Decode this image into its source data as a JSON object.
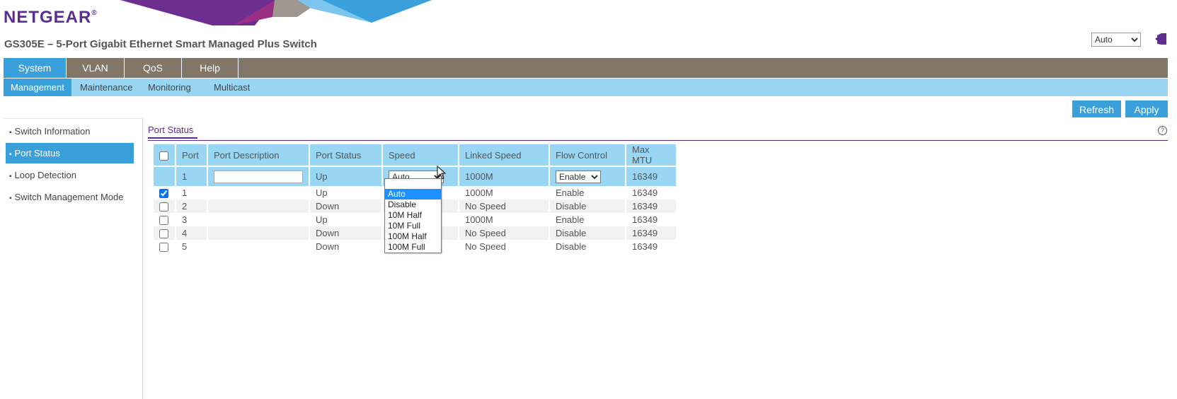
{
  "header": {
    "logo": "NETGEAR",
    "logo_mark": "®",
    "product_title": "GS305E – 5-Port Gigabit Ethernet Smart Managed Plus Switch",
    "language_value": "Auto"
  },
  "main_nav": [
    {
      "label": "System",
      "active": true
    },
    {
      "label": "VLAN",
      "active": false
    },
    {
      "label": "QoS",
      "active": false
    },
    {
      "label": "Help",
      "active": false
    }
  ],
  "sub_nav": [
    {
      "label": "Management",
      "active": true
    },
    {
      "label": "Maintenance",
      "active": false
    },
    {
      "label": "Monitoring",
      "active": false
    },
    {
      "label": "Multicast",
      "active": false
    }
  ],
  "actions": {
    "refresh": "Refresh",
    "apply": "Apply"
  },
  "sidebar": [
    {
      "label": "Switch Information",
      "active": false
    },
    {
      "label": "Port Status",
      "active": true
    },
    {
      "label": "Loop Detection",
      "active": false
    },
    {
      "label": "Switch Management Mode",
      "active": false
    }
  ],
  "bullet": "▪",
  "section": {
    "tab": "Port Status",
    "help": "?"
  },
  "table": {
    "headers": [
      "Port",
      "Port Description",
      "Port Status",
      "Speed",
      "Linked Speed",
      "Flow Control",
      "Max MTU"
    ],
    "edit_row": {
      "port": "1",
      "description": "",
      "status": "Up",
      "speed": "Auto",
      "linked_speed": "1000M",
      "flow_control": "Enable",
      "mtu": "16349"
    },
    "rows": [
      {
        "checked": true,
        "port": "1",
        "status": "Up",
        "linked_speed": "1000M",
        "flow_control": "Enable",
        "mtu": "16349"
      },
      {
        "checked": false,
        "port": "2",
        "status": "Down",
        "linked_speed": "No Speed",
        "flow_control": "Disable",
        "mtu": "16349"
      },
      {
        "checked": false,
        "port": "3",
        "status": "Up",
        "linked_speed": "1000M",
        "flow_control": "Enable",
        "mtu": "16349"
      },
      {
        "checked": false,
        "port": "4",
        "status": "Down",
        "linked_speed": "No Speed",
        "flow_control": "Disable",
        "mtu": "16349"
      },
      {
        "checked": false,
        "port": "5",
        "status": "Down",
        "linked_speed": "No Speed",
        "flow_control": "Disable",
        "mtu": "16349"
      }
    ]
  },
  "speed_options": [
    "Auto",
    "Disable",
    "10M Half",
    "10M Full",
    "100M Half",
    "100M Full"
  ],
  "speed_selected": "Auto",
  "flow_options": [
    "Enable",
    "Disable"
  ],
  "colors": {
    "brand_purple": "#5c2d91",
    "accent_blue": "#3aa0dc",
    "nav_brown": "#817668",
    "sub_nav_blue": "#99d6f4"
  }
}
